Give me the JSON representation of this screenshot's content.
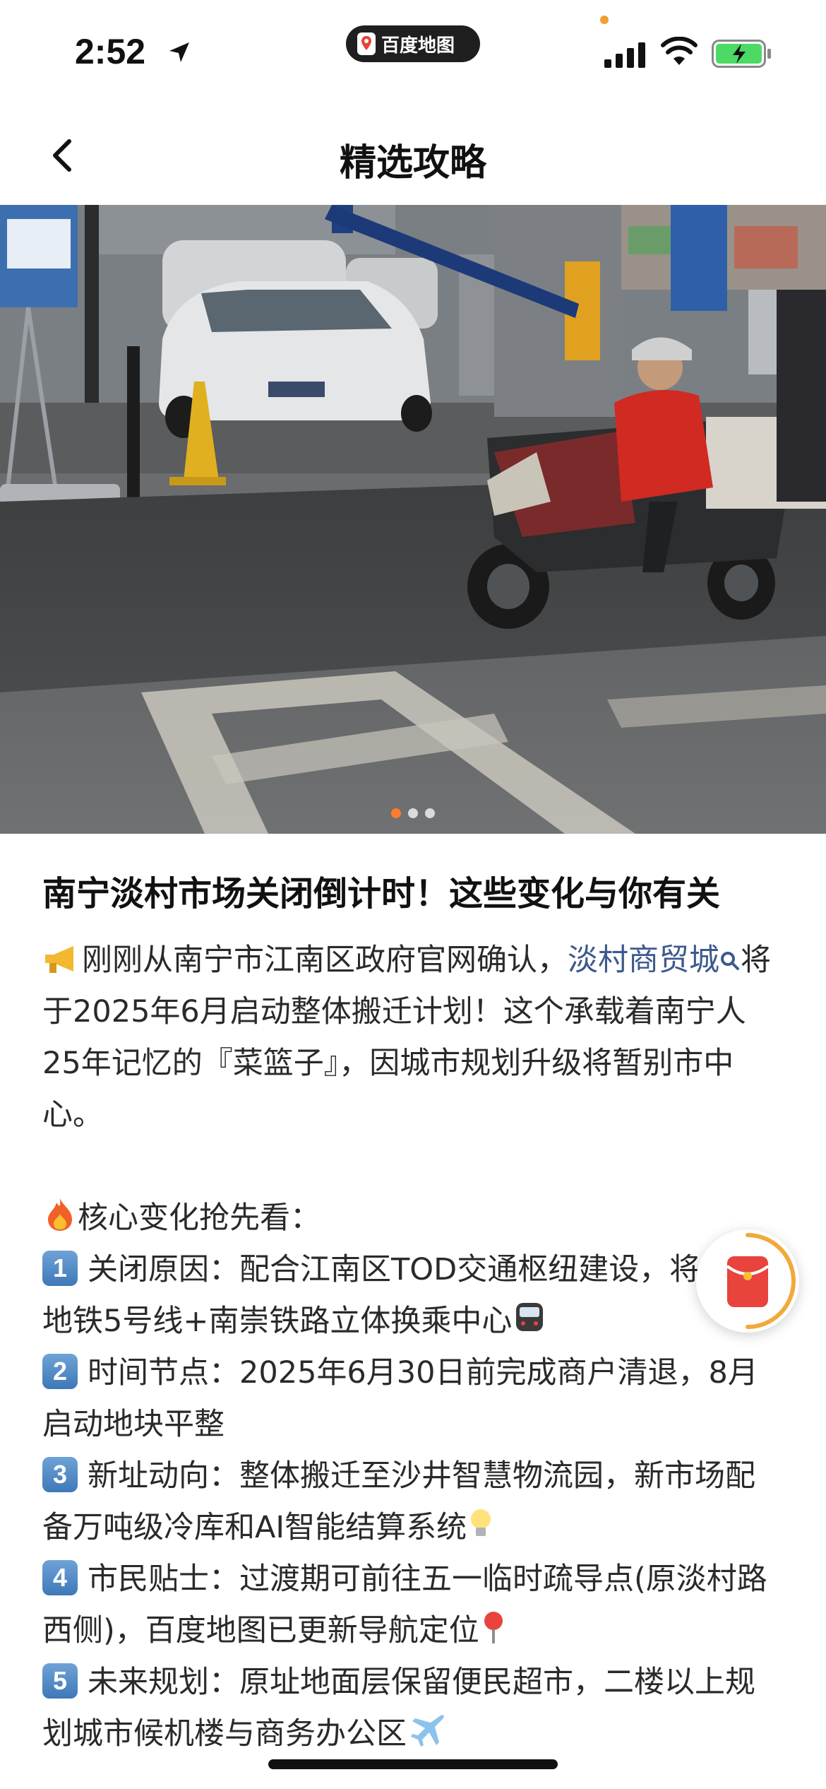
{
  "status_bar": {
    "time": "2:52",
    "app_name": "百度地图",
    "icons": [
      "location-arrow-icon",
      "signal-icon",
      "wifi-icon",
      "battery-charging-icon"
    ]
  },
  "nav": {
    "title": "精选攻略",
    "back_icon": "chevron-left-icon"
  },
  "hero": {
    "image_count": 3,
    "active_index": 0,
    "accent_color": "#ff7b2e"
  },
  "article": {
    "title": "南宁淡村市场关闭倒计时！这些变化与你有关",
    "intro_prefix": "刚刚从南宁市江南区政府官网确认，",
    "intro_link": "淡村商贸城",
    "intro_suffix": "将于2025年6月启动整体搬迁计划！这个承载着南宁人25年记忆的『菜篮子』，因城市规划升级将暂别市中心。",
    "section_heading": "核心变化抢先看：",
    "items": [
      {
        "num": "1",
        "text": "关闭原因：配合江南区TOD交通枢纽建设，将打造地铁5号线+南崇铁路立体换乘中心"
      },
      {
        "num": "2",
        "text": "时间节点：2025年6月30日前完成商户清退，8月启动地块平整"
      },
      {
        "num": "3",
        "text": "新址动向：整体搬迁至沙井智慧物流园，新市场配备万吨级冷库和AI智能结算系统"
      },
      {
        "num": "4",
        "text": "市民贴士：过渡期可前往五一临时疏导点(原淡村路西侧)，百度地图已更新导航定位"
      },
      {
        "num": "5",
        "text": "未来规划：原址地面层保留便民超市，二楼以上规划城市候机楼与商务办公区"
      }
    ]
  },
  "float_button": {
    "icon": "red-packet-icon",
    "color": "#e8433c"
  }
}
